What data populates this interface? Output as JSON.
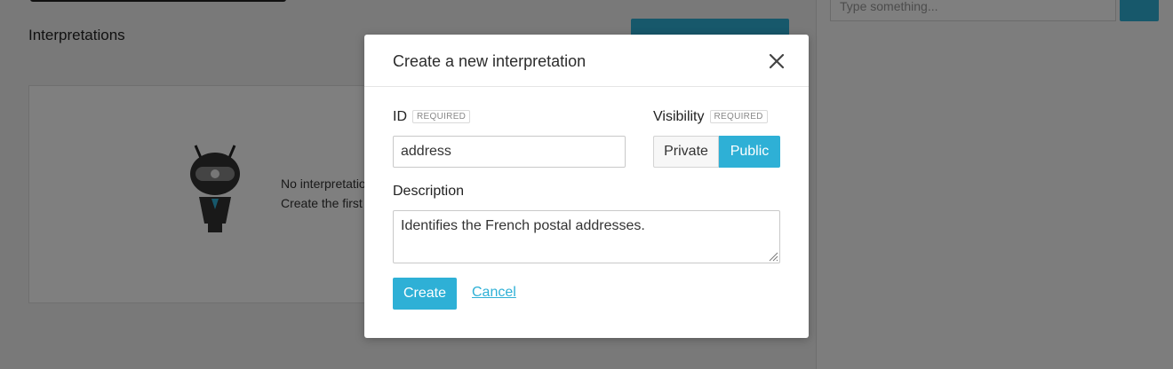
{
  "background": {
    "section_title": "Interpretations",
    "search_placeholder": "Type something..."
  },
  "modal": {
    "title": "Create a new interpretation",
    "id_label": "ID",
    "id_required": "REQUIRED",
    "id_value": "address",
    "visibility_label": "Visibility",
    "visibility_required": "REQUIRED",
    "visibility_options": [
      "Private",
      "Public"
    ],
    "visibility_selected": "Public",
    "description_label": "Description",
    "description_value": "Identifies the French postal addresses.",
    "create_label": "Create",
    "cancel_label": "Cancel"
  },
  "colors": {
    "accent": "#2eb0d6",
    "overlay": "rgba(0,0,0,0.5)"
  },
  "icons": [
    "close-icon",
    "robot-illustration",
    "resize-grip-icon"
  ]
}
